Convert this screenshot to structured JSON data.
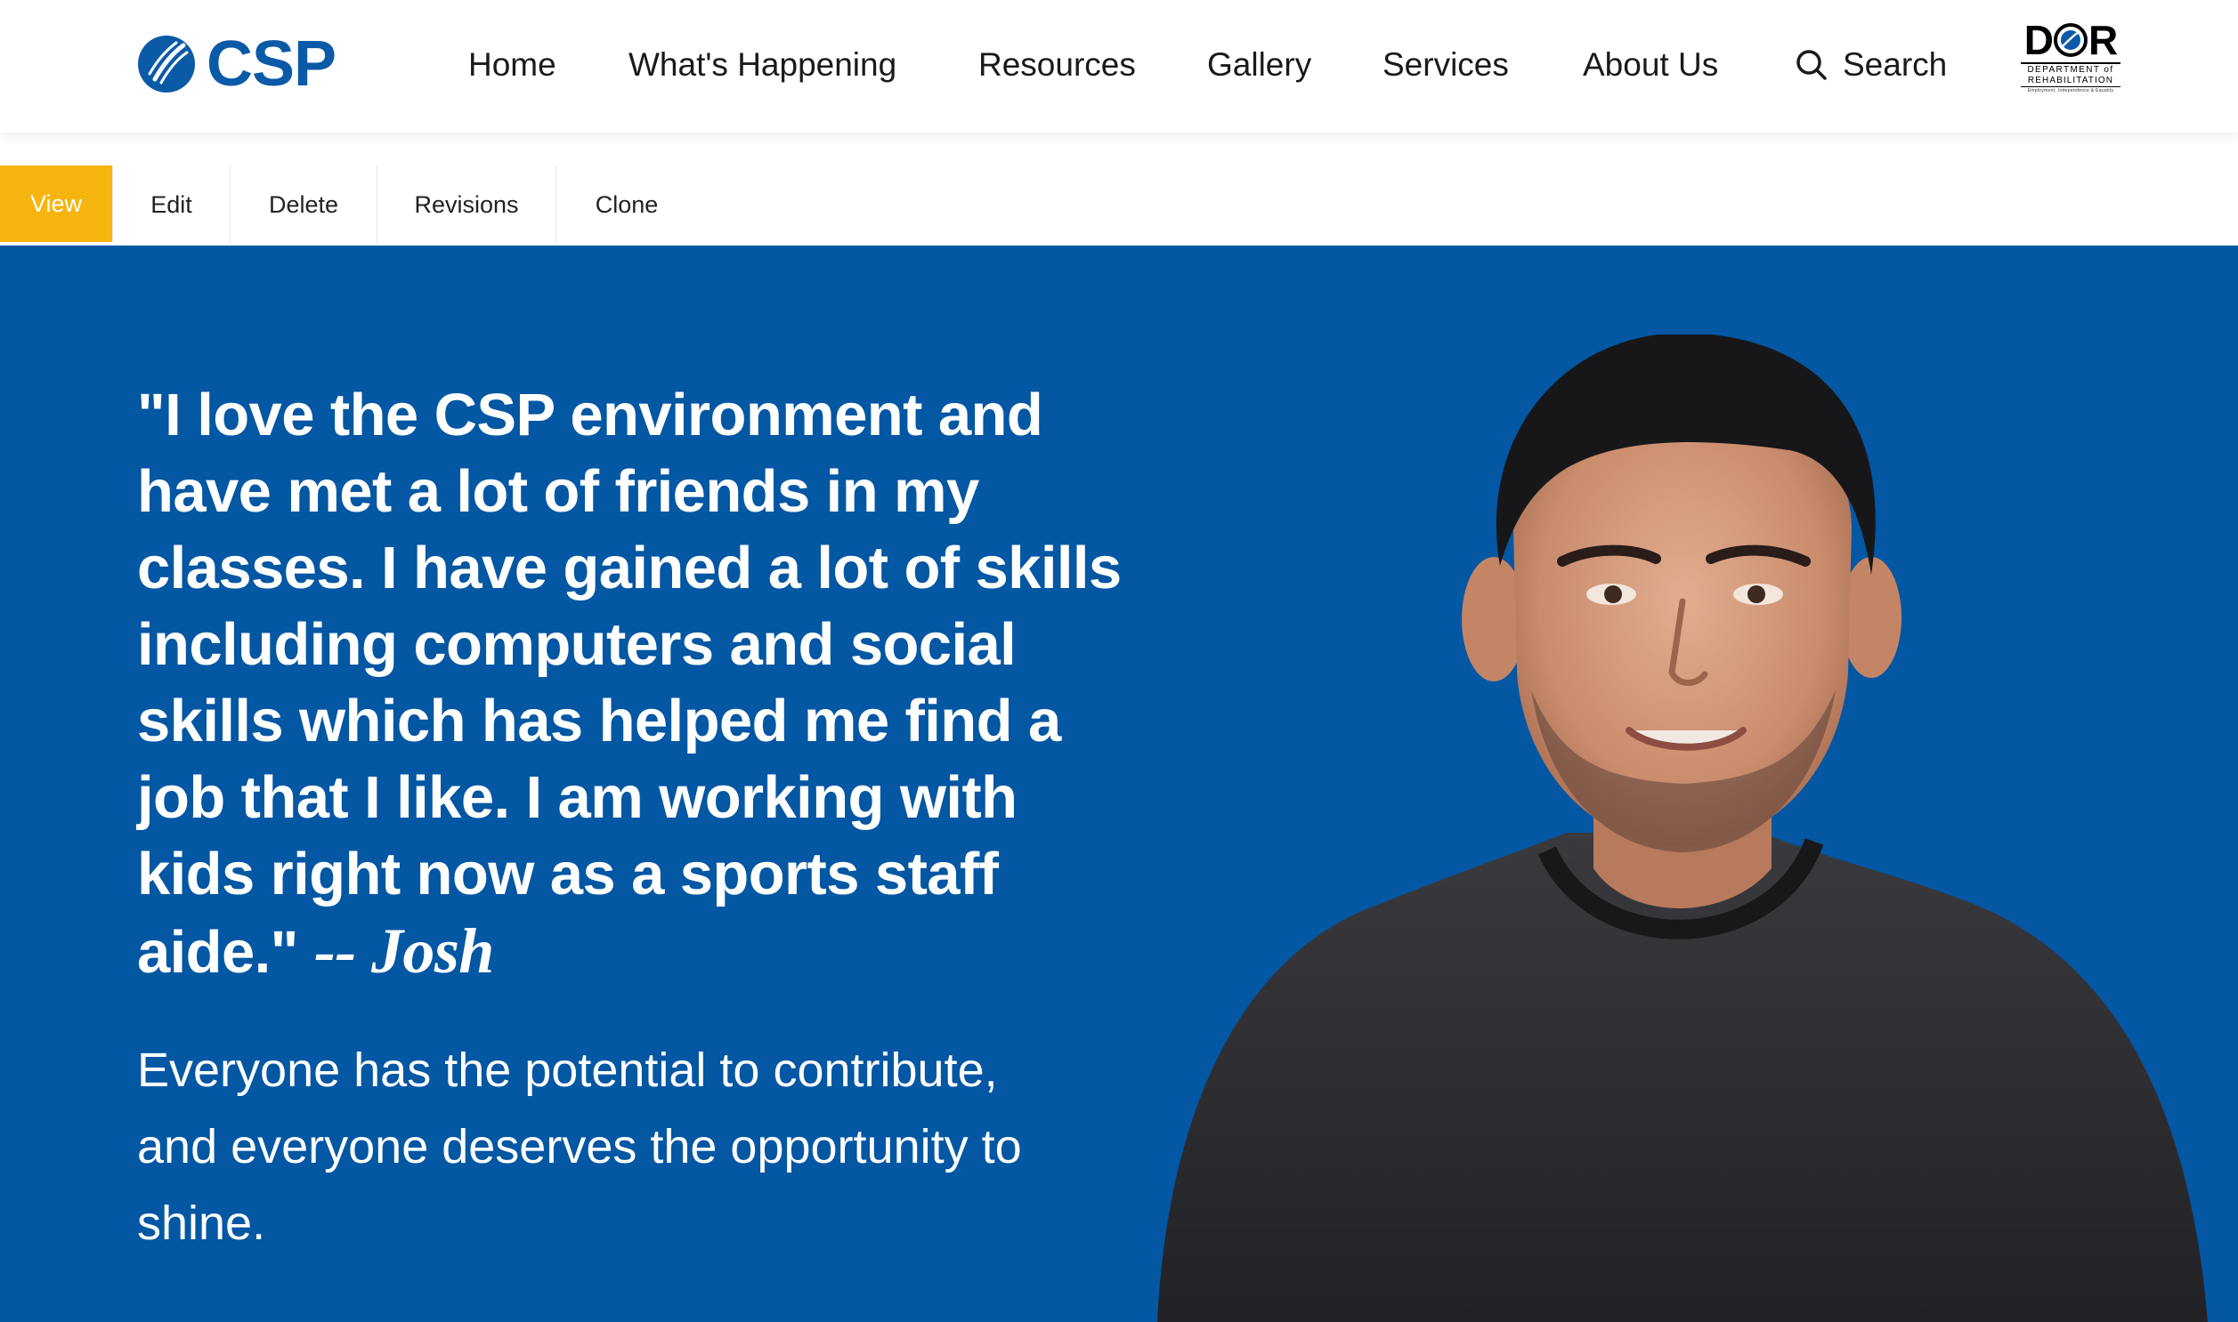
{
  "brand": {
    "name": "CSP",
    "color": "#0b5aa8"
  },
  "nav": {
    "items": [
      {
        "label": "Home"
      },
      {
        "label": "What's Happening"
      },
      {
        "label": "Resources"
      },
      {
        "label": "Gallery"
      },
      {
        "label": "Services"
      },
      {
        "label": "About Us"
      }
    ],
    "search_label": "Search",
    "search_icon": "search-icon"
  },
  "partner_logo": {
    "word": "DOR",
    "line1": "DEPARTMENT of",
    "line2": "REHABILITATION",
    "line3": "Employment, Independence & Equality"
  },
  "admin_tabs": [
    {
      "label": "View",
      "active": true
    },
    {
      "label": "Edit",
      "active": false
    },
    {
      "label": "Delete",
      "active": false
    },
    {
      "label": "Revisions",
      "active": false
    },
    {
      "label": "Clone",
      "active": false
    }
  ],
  "hero": {
    "quote": "\"I love the CSP environment and have met a lot of friends in my classes. I have gained a lot of skills including computers and social skills which has helped me find a job that I like. I am working with kids right now as a sports staff aide.\"",
    "attribution": "-- Josh",
    "tagline": "Everyone has the potential to contribute, and everyone deserves the opportunity to shine.",
    "background": "#0357a3"
  },
  "colors": {
    "accent": "#f6b40e",
    "primary": "#0357a3"
  }
}
